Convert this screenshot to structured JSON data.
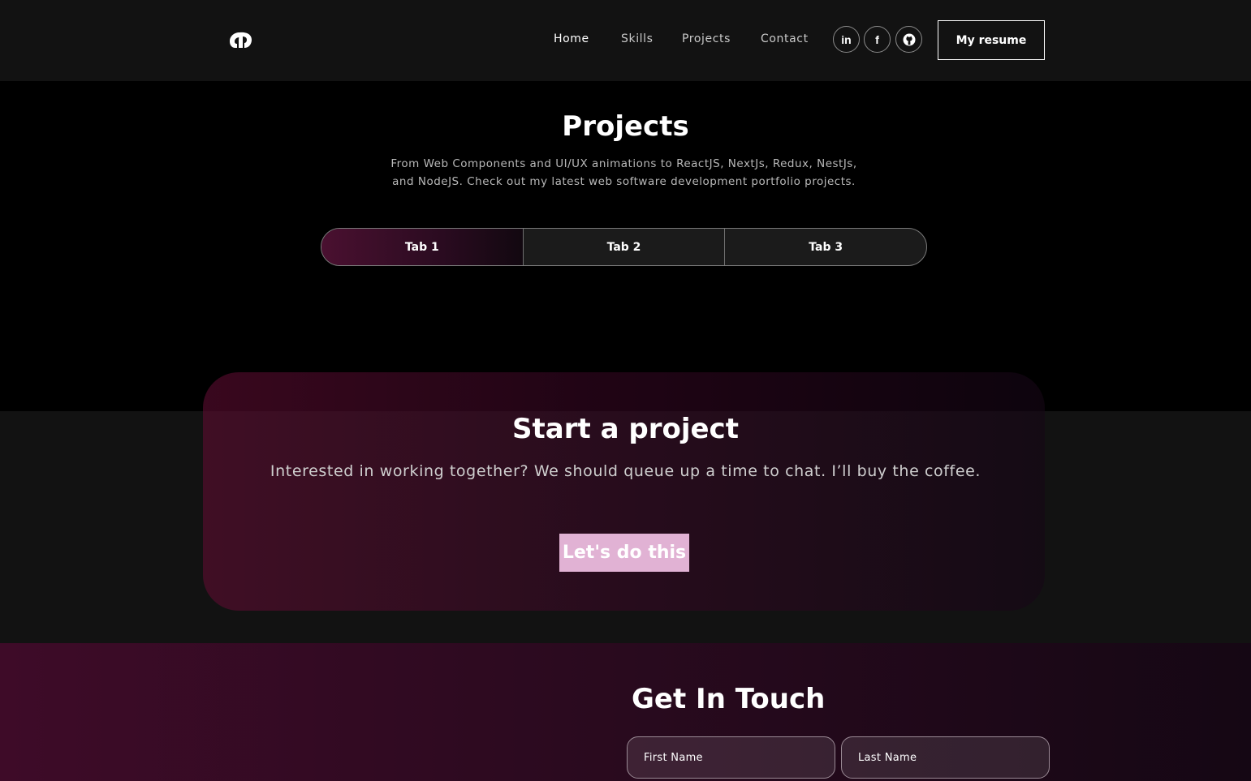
{
  "nav": {
    "logo_icon": "mc-logo-icon",
    "links": [
      {
        "label": "Home",
        "active": true
      },
      {
        "label": "Skills",
        "active": false
      },
      {
        "label": "Projects",
        "active": false
      },
      {
        "label": "Contact",
        "active": false
      }
    ],
    "social": [
      {
        "name": "linkedin",
        "glyph": "in"
      },
      {
        "name": "facebook",
        "glyph": "f"
      },
      {
        "name": "github",
        "glyph": ""
      }
    ],
    "resume_label": "My resume"
  },
  "projects": {
    "title": "Projects",
    "description": "From Web Components and UI/UX animations to ReactJS, NextJs, Redux, NestJs, and NodeJS. Check out my latest web software development portfolio projects.",
    "tabs": [
      {
        "label": "Tab 1",
        "active": true
      },
      {
        "label": "Tab 2",
        "active": false
      },
      {
        "label": "Tab 3",
        "active": false
      }
    ]
  },
  "cta": {
    "title": "Start a project",
    "text": "Interested in working together? We should queue up a time to chat. I’ll buy the coffee.",
    "button_label": "Let's do this"
  },
  "contact": {
    "title": "Get In Touch",
    "first_name_placeholder": "First Name",
    "last_name_placeholder": "Last Name"
  },
  "colors": {
    "nav_bg": "#121212",
    "page_bg": "#000000",
    "accent_pink": "#e1b2d4",
    "gradient_start": "#3e0b28",
    "gradient_end": "#150714"
  }
}
